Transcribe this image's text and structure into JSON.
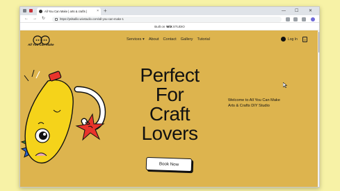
{
  "browser": {
    "tab_title": "All You Can Make | arts & crafts |",
    "tab_close": "×",
    "new_tab": "+",
    "url": "https://pslsallio.wixstudio.com/all-you-can-make-1",
    "back": "←",
    "forward": "→",
    "reload": "↻",
    "minimize": "—",
    "maximize": "☐",
    "close": "✕"
  },
  "wix_banner": {
    "text": "Built on",
    "brand": "WiX",
    "brand_suffix": "STUDIO"
  },
  "site": {
    "logo_text": "All You Can Make",
    "nav": {
      "services": "Services",
      "about": "About",
      "contact": "Contact",
      "gallery": "Gallery",
      "tutorial": "Tutorial"
    },
    "login_label": "Log In",
    "cart_count": "0",
    "hero_lines": [
      "Perfect",
      "For",
      "Craft",
      "Lovers"
    ],
    "welcome_text": "Welcome to All You Can Make Arts & Crafts DIY Studio",
    "cta_label": "Book Now"
  },
  "colors": {
    "page_bg": "#f7f2a6",
    "site_bg": "#ddb44e",
    "accent_yellow": "#f5d31a",
    "accent_red": "#e9342b",
    "accent_green": "#2e9a4a",
    "accent_blue": "#2b63c9"
  }
}
